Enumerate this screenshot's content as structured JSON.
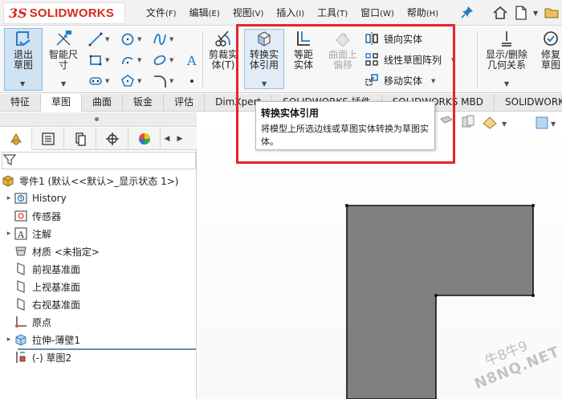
{
  "app": {
    "logo_prefix": "3S",
    "logo_word": "SOLIDWORKS"
  },
  "menu": [
    {
      "label": "文件",
      "key": "(F)"
    },
    {
      "label": "编辑",
      "key": "(E)"
    },
    {
      "label": "视图",
      "key": "(V)"
    },
    {
      "label": "插入",
      "key": "(I)"
    },
    {
      "label": "工具",
      "key": "(T)"
    },
    {
      "label": "窗口",
      "key": "(W)"
    },
    {
      "label": "帮助",
      "key": "(H)"
    }
  ],
  "ribbon": {
    "exit_sketch": "退出草图",
    "smart_dimension": "智能尺寸",
    "trim": "剪裁实体(T)",
    "convert": "转换实体引用",
    "offset": "等距实体",
    "offset_surface": "曲面上偏移",
    "mirror": "镜向实体",
    "linear_pattern": "线性草图阵列",
    "move": "移动实体",
    "display_delete": "显示/删除几何关系",
    "repair": "修复草图"
  },
  "tabs": [
    "特征",
    "草图",
    "曲面",
    "钣金",
    "评估",
    "DimXpert",
    "SOLIDWORKS 插件",
    "SOLIDWORKS MBD",
    "SOLIDWORKS CAM"
  ],
  "tooltip": {
    "title": "转换实体引用",
    "body": "将模型上所选边线或草图实体转换为草图实体。"
  },
  "tree": {
    "root": "零件1 (默认<<默认>_显示状态 1>)",
    "items": [
      {
        "label": "History",
        "icon": "history-icon",
        "expandable": true
      },
      {
        "label": "传感器",
        "icon": "sensor-icon",
        "expandable": false
      },
      {
        "label": "注解",
        "icon": "annotation-icon",
        "expandable": true
      },
      {
        "label": "材质 <未指定>",
        "icon": "material-icon",
        "expandable": false
      },
      {
        "label": "前视基准面",
        "icon": "plane-icon",
        "expandable": false
      },
      {
        "label": "上视基准面",
        "icon": "plane-icon",
        "expandable": false
      },
      {
        "label": "右视基准面",
        "icon": "plane-icon",
        "expandable": false
      },
      {
        "label": "原点",
        "icon": "origin-icon",
        "expandable": false
      },
      {
        "label": "拉伸-薄壁1",
        "icon": "extrude-thin-icon",
        "expandable": true
      },
      {
        "label": "(-) 草图2",
        "icon": "sketch-icon",
        "expandable": false
      }
    ]
  },
  "watermark": {
    "line1": "牛8牛9",
    "line2": "N8NQ.NET"
  },
  "colors": {
    "accent": "#2a7bc0",
    "highlight_box": "#e3262c",
    "shape_fill": "#808080",
    "logo": "#d52b1e"
  }
}
